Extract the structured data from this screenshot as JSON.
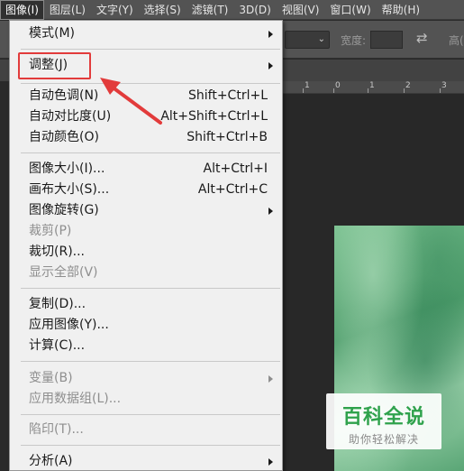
{
  "menubar": {
    "items": [
      {
        "label": "图像(I)",
        "active": true
      },
      {
        "label": "图层(L)"
      },
      {
        "label": "文字(Y)"
      },
      {
        "label": "选择(S)"
      },
      {
        "label": "滤镜(T)"
      },
      {
        "label": "3D(D)"
      },
      {
        "label": "视图(V)"
      },
      {
        "label": "窗口(W)"
      },
      {
        "label": "帮助(H)"
      }
    ]
  },
  "options_bar": {
    "width_label": "宽度:",
    "height_label_partial": "高("
  },
  "ruler": {
    "labels": [
      "1",
      "0",
      "1",
      "2",
      "3"
    ]
  },
  "image_menu": {
    "items": [
      {
        "label": "模式(M)",
        "submenu": true
      },
      {
        "label": "调整(J)",
        "submenu": true
      },
      {
        "label": "自动色调(N)",
        "shortcut": "Shift+Ctrl+L"
      },
      {
        "label": "自动对比度(U)",
        "shortcut": "Alt+Shift+Ctrl+L"
      },
      {
        "label": "自动颜色(O)",
        "shortcut": "Shift+Ctrl+B"
      },
      {
        "label": "图像大小(I)...",
        "shortcut": "Alt+Ctrl+I"
      },
      {
        "label": "画布大小(S)...",
        "shortcut": "Alt+Ctrl+C"
      },
      {
        "label": "图像旋转(G)",
        "submenu": true
      },
      {
        "label": "裁剪(P)",
        "disabled": true
      },
      {
        "label": "裁切(R)..."
      },
      {
        "label": "显示全部(V)",
        "disabled": true
      },
      {
        "label": "复制(D)..."
      },
      {
        "label": "应用图像(Y)..."
      },
      {
        "label": "计算(C)..."
      },
      {
        "label": "变量(B)",
        "submenu": true,
        "disabled": true
      },
      {
        "label": "应用数据组(L)...",
        "disabled": true
      },
      {
        "label": "陷印(T)...",
        "disabled": true
      },
      {
        "label": "分析(A)",
        "submenu": true
      }
    ]
  },
  "watermark": {
    "title": "百科全说",
    "subtitle": "助你轻松解决"
  },
  "annotation": {
    "color": "#e23b3b"
  },
  "colors": {
    "menubar_bg": "#535353",
    "menu_bg": "#f0f0f0",
    "disabled_text": "#8e8e8e"
  }
}
